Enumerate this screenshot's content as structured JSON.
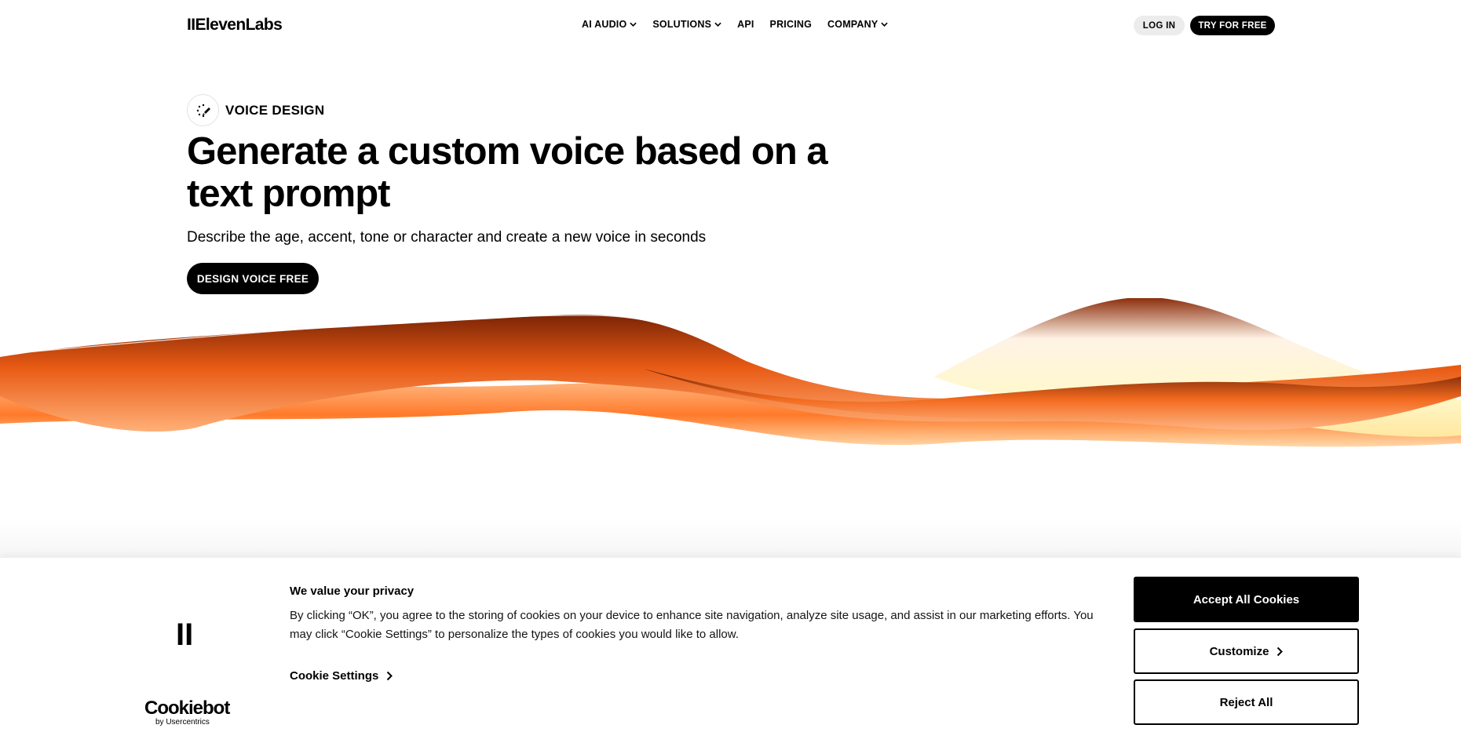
{
  "header": {
    "logo": "IIElevenLabs",
    "nav": [
      {
        "label": "AI AUDIO",
        "dropdown": true
      },
      {
        "label": "SOLUTIONS",
        "dropdown": true
      },
      {
        "label": "API",
        "dropdown": false
      },
      {
        "label": "PRICING",
        "dropdown": false
      },
      {
        "label": "COMPANY",
        "dropdown": true
      }
    ],
    "login_label": "LOG IN",
    "try_label": "TRY FOR FREE"
  },
  "hero": {
    "badge_label": "VOICE DESIGN",
    "title": "Generate a custom voice based on a text prompt",
    "subtitle": "Describe the age, accent, tone or character and create a new voice in seconds",
    "cta_label": "DESIGN VOICE FREE"
  },
  "cookie": {
    "logo": "II",
    "title": "We value your privacy",
    "text": "By clicking “OK”, you agree to the storing of cookies on your device to enhance site navigation, analyze site usage, and assist in our marketing efforts. You may click “Cookie Settings” to personalize the types of cookies you would like to allow.",
    "settings_label": "Cookie Settings",
    "brand_name": "Cookiebot",
    "brand_sub": "by Usercentrics",
    "accept_label": "Accept All Cookies",
    "customize_label": "Customize",
    "reject_label": "Reject All"
  },
  "colors": {
    "accent_orange": "#ff6f1f",
    "dark_orange": "#8a2a08",
    "cream": "#fff6c8",
    "black": "#000000"
  }
}
